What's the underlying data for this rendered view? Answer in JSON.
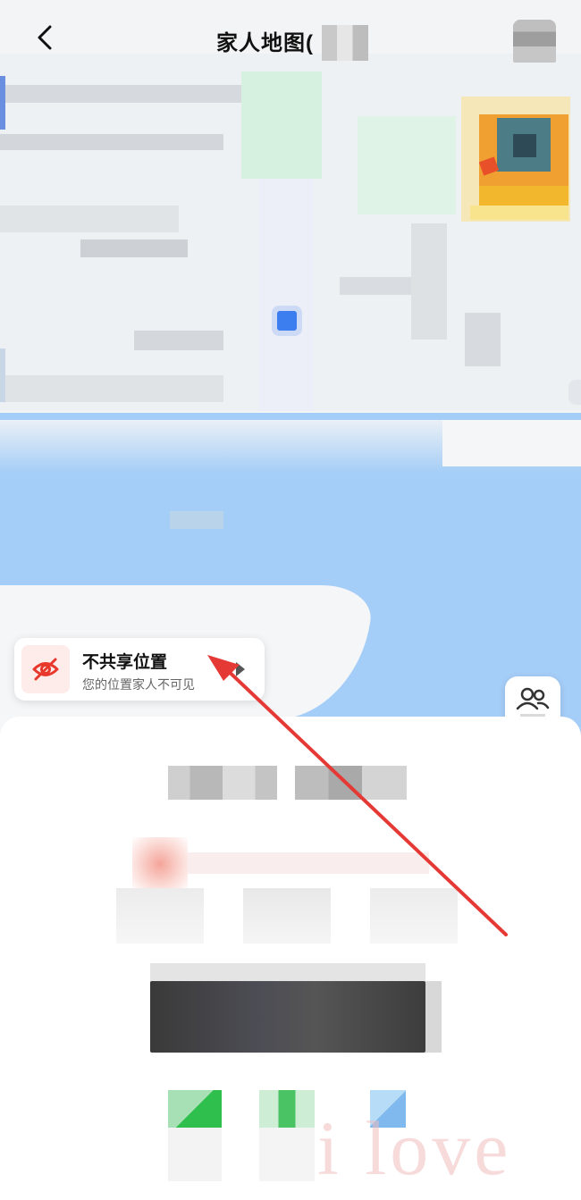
{
  "header": {
    "title": "家人地图("
  },
  "share_status": {
    "title": "不共享位置",
    "subtitle": "您的位置家人不可见"
  },
  "watermark": "i love",
  "icons": {
    "back": "chevron-left-icon",
    "menu": "more-icon",
    "hidden": "eye-off-icon",
    "family": "people-icon",
    "user_marker": "location-marker-icon"
  },
  "colors": {
    "water": "#a4cdf7",
    "accent_red": "#e8382b",
    "icon_bg": "#fdecea",
    "annotation": "#e53935"
  }
}
